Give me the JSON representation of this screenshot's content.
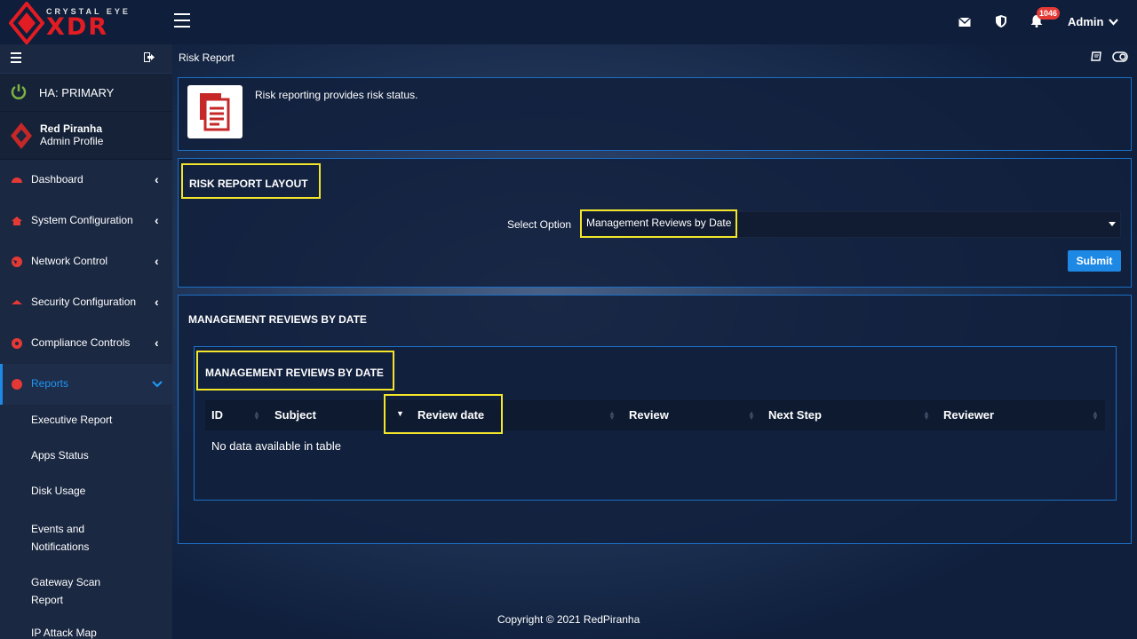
{
  "brand": {
    "top": "CRYSTAL EYE",
    "main": "XDR"
  },
  "topbar": {
    "notif_count": "1046",
    "admin_label": "Admin"
  },
  "sidebar": {
    "ha_label": "HA: PRIMARY",
    "profile_name": "Red Piranha",
    "profile_role": "Admin Profile",
    "nav": [
      {
        "label": "Dashboard"
      },
      {
        "label": "System Configuration"
      },
      {
        "label": "Network Control"
      },
      {
        "label": "Security Configuration"
      },
      {
        "label": "Compliance Controls"
      },
      {
        "label": "Reports"
      }
    ],
    "sub": [
      {
        "label": "Executive Report"
      },
      {
        "label": "Apps Status"
      },
      {
        "label": "Disk Usage"
      },
      {
        "label": "Events and Notifications"
      },
      {
        "label": "Gateway Scan Report"
      },
      {
        "label": "IP Attack Map"
      }
    ]
  },
  "breadcrumb": "Risk Report",
  "info": {
    "text": "Risk reporting provides risk status."
  },
  "layout_panel": {
    "title": "RISK REPORT LAYOUT",
    "select_label": "Select Option",
    "select_value": "Management Reviews by Date",
    "submit_label": "Submit"
  },
  "result_panel": {
    "title": "MANAGEMENT REVIEWS BY DATE",
    "inner_title": "MANAGEMENT REVIEWS BY DATE",
    "columns": [
      "ID",
      "Subject",
      "Review date",
      "Review",
      "Next Step",
      "Reviewer"
    ],
    "empty_text": "No data available in table"
  },
  "footer": "Copyright © 2021 RedPiranha",
  "colors": {
    "accent": "#1e88e5",
    "brand_red": "#e21c23",
    "highlight": "#f2e52a"
  }
}
